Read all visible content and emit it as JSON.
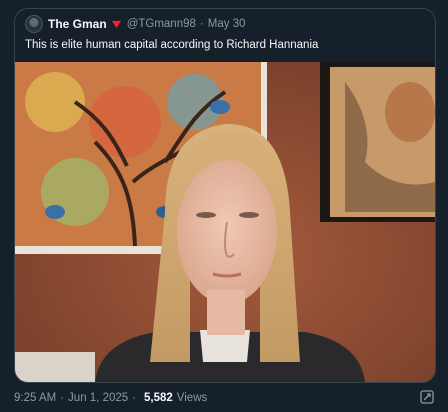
{
  "quoted_post": {
    "author_name": "The Gman",
    "author_handle": "@TGmann98",
    "separator": "·",
    "date": "May 30",
    "text": "This is elite human capital according to Richard Hannania"
  },
  "post_meta": {
    "time": "9:25 AM",
    "separator": "·",
    "date": "Jun 1, 2025",
    "separator2": "·",
    "views_count": "5,582",
    "views_label": "Views"
  },
  "colors": {
    "background": "#15202b",
    "text_primary": "#f7f9f9",
    "text_secondary": "#8b98a5",
    "badge": "#f4212e"
  }
}
